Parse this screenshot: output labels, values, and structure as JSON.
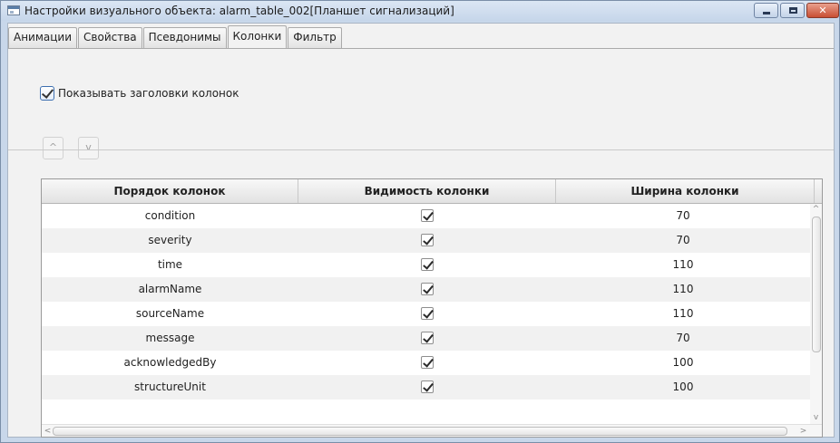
{
  "window": {
    "title": "Настройки визуального объекта: alarm_table_002[Планшет сигнализаций]",
    "icon": "window-icon",
    "controls": {
      "minimize": "minimize-icon",
      "maximize": "maximize-icon",
      "close": "close-icon",
      "close_glyph": "✕"
    }
  },
  "tabs": [
    {
      "label": "Анимации",
      "active": false
    },
    {
      "label": "Свойства",
      "active": false
    },
    {
      "label": "Псевдонимы",
      "active": false
    },
    {
      "label": "Колонки",
      "active": true
    },
    {
      "label": "Фильтр",
      "active": false
    }
  ],
  "show_headers": {
    "label": "Показывать заголовки колонок",
    "checked": true
  },
  "move_buttons": {
    "up_glyph": "^",
    "down_glyph": "v"
  },
  "table": {
    "headers": [
      "Порядок колонок",
      "Видимость колонки",
      "Ширина колонки"
    ],
    "rows": [
      {
        "name": "condition",
        "visible": true,
        "width": "70"
      },
      {
        "name": "severity",
        "visible": true,
        "width": "70"
      },
      {
        "name": "time",
        "visible": true,
        "width": "110"
      },
      {
        "name": "alarmName",
        "visible": true,
        "width": "110"
      },
      {
        "name": "sourceName",
        "visible": true,
        "width": "110"
      },
      {
        "name": "message",
        "visible": true,
        "width": "70"
      },
      {
        "name": "acknowledgedBy",
        "visible": true,
        "width": "100"
      },
      {
        "name": "structureUnit",
        "visible": true,
        "width": "100"
      }
    ]
  },
  "scroll_glyphs": {
    "up": "^",
    "down": "v",
    "left": "<",
    "right": ">"
  }
}
